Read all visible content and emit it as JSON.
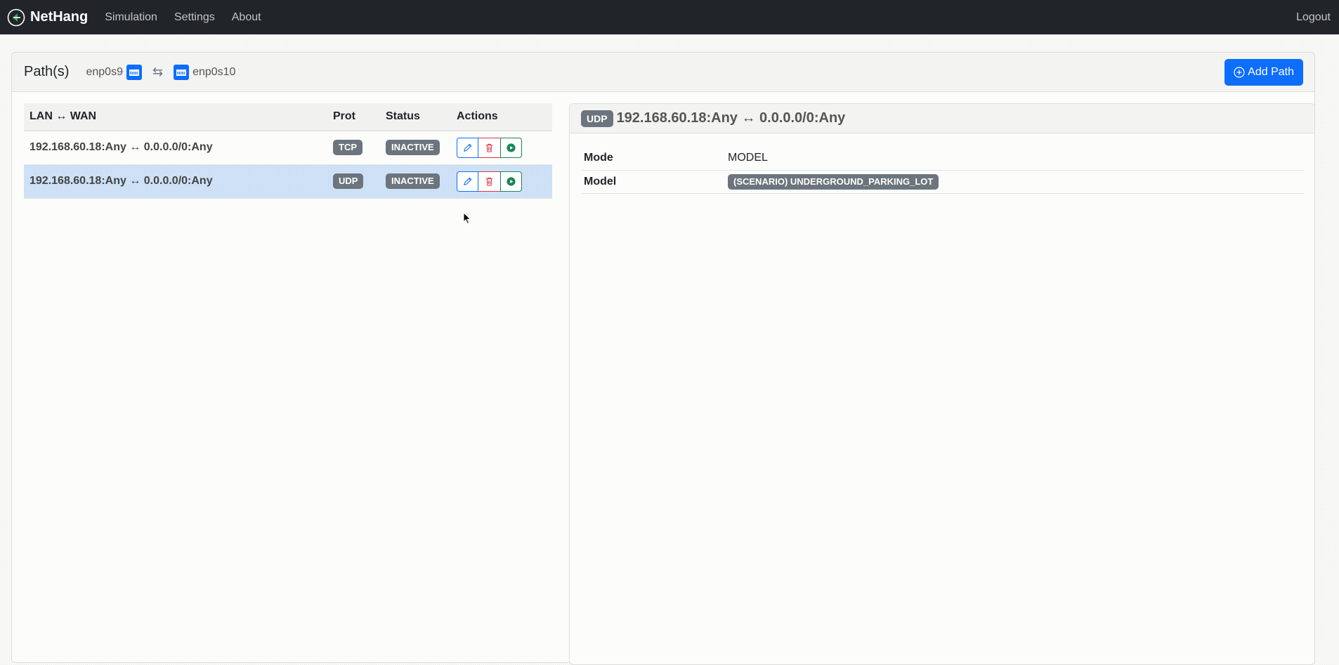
{
  "navbar": {
    "brand": "NetHang",
    "links": [
      "Simulation",
      "Settings",
      "About"
    ],
    "logout": "Logout"
  },
  "header": {
    "title": "Path(s)",
    "iface_lan": "enp0s9",
    "iface_wan": "enp0s10",
    "swap_symbol": "⇆",
    "add_path_label": "Add Path"
  },
  "paths_table": {
    "columns": [
      "LAN ↔ WAN",
      "Prot",
      "Status",
      "Actions"
    ],
    "rows": [
      {
        "route": "192.168.60.18:Any ↔ 0.0.0.0/0:Any",
        "prot": "TCP",
        "status": "INACTIVE",
        "selected": false
      },
      {
        "route": "192.168.60.18:Any ↔ 0.0.0.0/0:Any",
        "prot": "UDP",
        "status": "INACTIVE",
        "selected": true
      }
    ]
  },
  "detail": {
    "prot": "UDP",
    "route": "192.168.60.18:Any ↔ 0.0.0.0/0:Any",
    "mode_label": "Mode",
    "mode_value": "MODEL",
    "model_label": "Model",
    "model_value": "(SCENARIO) UNDERGROUND_PARKING_LOT"
  },
  "colors": {
    "navbar": "#212529",
    "primary": "#0d6efd",
    "danger": "#dc3545",
    "success": "#198754",
    "badge": "#6c757d",
    "selected_row": "#cfe2f7"
  }
}
